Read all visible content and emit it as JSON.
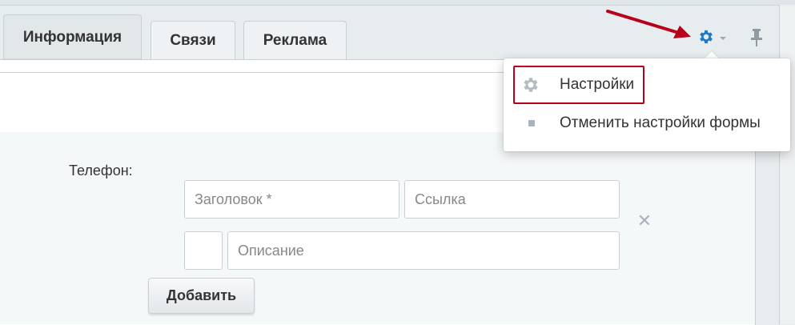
{
  "tabs": [
    {
      "label": "Информация",
      "active": true
    },
    {
      "label": "Связи",
      "active": false
    },
    {
      "label": "Реклама",
      "active": false
    }
  ],
  "form": {
    "phone_label": "Телефон:",
    "title_placeholder": "Заголовок *",
    "link_placeholder": "Ссылка",
    "description_placeholder": "Описание",
    "remove_symbol": "✕",
    "add_button": "Добавить"
  },
  "toolbar": {
    "settings_icon": "gear-icon",
    "pin_icon": "pin-icon"
  },
  "settings_menu": {
    "items": [
      {
        "label": "Настройки",
        "icon": "gear-icon"
      },
      {
        "label": "Отменить настройки формы",
        "icon": "square-bullet-icon"
      }
    ]
  },
  "colors": {
    "accent_blue": "#1f7bc7",
    "annotation_red": "#b8001c"
  }
}
